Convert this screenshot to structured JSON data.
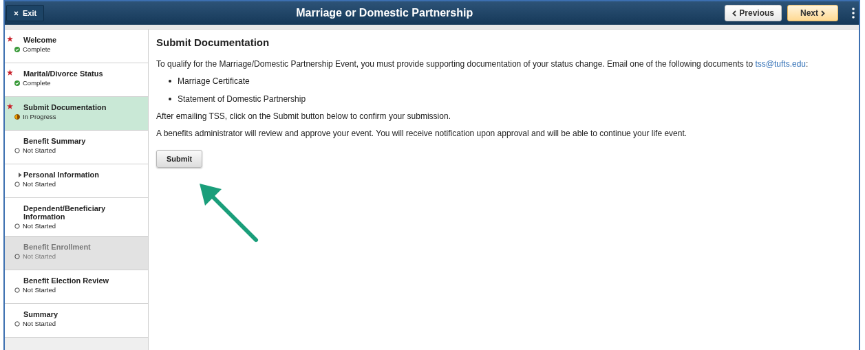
{
  "header": {
    "exit_label": "Exit",
    "title": "Marriage or Domestic Partnership",
    "previous_label": "Previous",
    "next_label": "Next"
  },
  "steps": [
    {
      "label": "Welcome",
      "status": "Complete",
      "kind": "complete",
      "required": true,
      "selected": false,
      "disabled": false
    },
    {
      "label": "Marital/Divorce Status",
      "status": "Complete",
      "kind": "complete",
      "required": true,
      "selected": false,
      "disabled": false
    },
    {
      "label": "Submit Documentation",
      "status": "In Progress",
      "kind": "in_progress",
      "required": true,
      "selected": true,
      "disabled": false
    },
    {
      "label": "Benefit Summary",
      "status": "Not Started",
      "kind": "not_started",
      "required": false,
      "selected": false,
      "disabled": false
    },
    {
      "label": "Personal Information",
      "status": "Not Started",
      "kind": "not_started",
      "required": false,
      "selected": false,
      "disabled": false,
      "expanded": false
    },
    {
      "label": "Dependent/Beneficiary Information",
      "status": "Not Started",
      "kind": "not_started",
      "required": false,
      "selected": false,
      "disabled": false
    },
    {
      "label": "Benefit Enrollment",
      "status": "Not Started",
      "kind": "not_started",
      "required": false,
      "selected": false,
      "disabled": true
    },
    {
      "label": "Benefit Election Review",
      "status": "Not Started",
      "kind": "not_started",
      "required": false,
      "selected": false,
      "disabled": false
    },
    {
      "label": "Summary",
      "status": "Not Started",
      "kind": "not_started",
      "required": false,
      "selected": false,
      "disabled": false
    }
  ],
  "content": {
    "heading": "Submit Documentation",
    "intro": "To qualify for the Marriage/Domestic Partnership Event, you must provide supporting documentation of your status change. Email one of the following documents to",
    "email": "tss@tufts.edu",
    "intro_end": ":",
    "documents": [
      "Marriage Certificate",
      "Statement of Domestic Partnership"
    ],
    "paragraphs": [
      "After emailing TSS, click on the Submit button below to confirm your submission.",
      "A benefits administrator will review and approve your event. You will receive notification upon approval and will be able to continue your life event."
    ],
    "submit_label": "Submit"
  }
}
